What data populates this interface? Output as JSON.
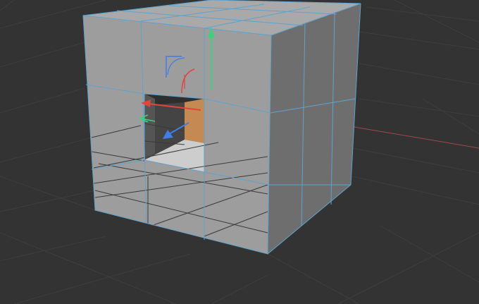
{
  "viewport": {
    "background": "#333333",
    "grid_color": "#3e3e3e",
    "grid_color_major": "#454545",
    "x_axis_color": "#a8454b",
    "selection_edge_color": "#5da3cf",
    "selected_polygon_color": "#c48a52",
    "face_colors": {
      "front": "#9d9d9d",
      "top": "#a9a9a9",
      "right": "#6e6e6e",
      "hole_wall": "#7c7c7c",
      "hole_floor": "#c7c7c7"
    }
  },
  "gizmo": {
    "x_axis_color": "#e0453c",
    "y_axis_color": "#3fd07a",
    "z_axis_color": "#3d7fe6",
    "rotation_handle_colors": {
      "x": "#e0453c",
      "z": "#3d7fe6"
    }
  }
}
